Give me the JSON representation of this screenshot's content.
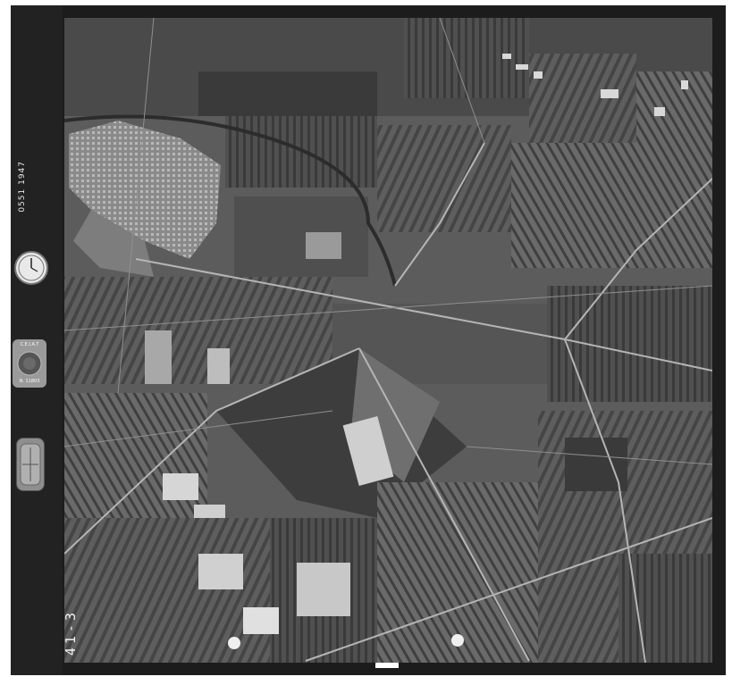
{
  "image": {
    "type": "aerial photograph",
    "frame_id": "41-3",
    "side_strip": {
      "frame_text": "0551 1947",
      "instruments": [
        "clock-icon",
        "altimeter-seal-icon",
        "bubble-level-icon"
      ]
    },
    "colors": {
      "border": "#1c1c1c",
      "fields_dark": "#3a3a3a",
      "fields_mid": "#6e6e6e",
      "fields_light": "#a9a9a9",
      "town": "#9b9b9b"
    }
  }
}
